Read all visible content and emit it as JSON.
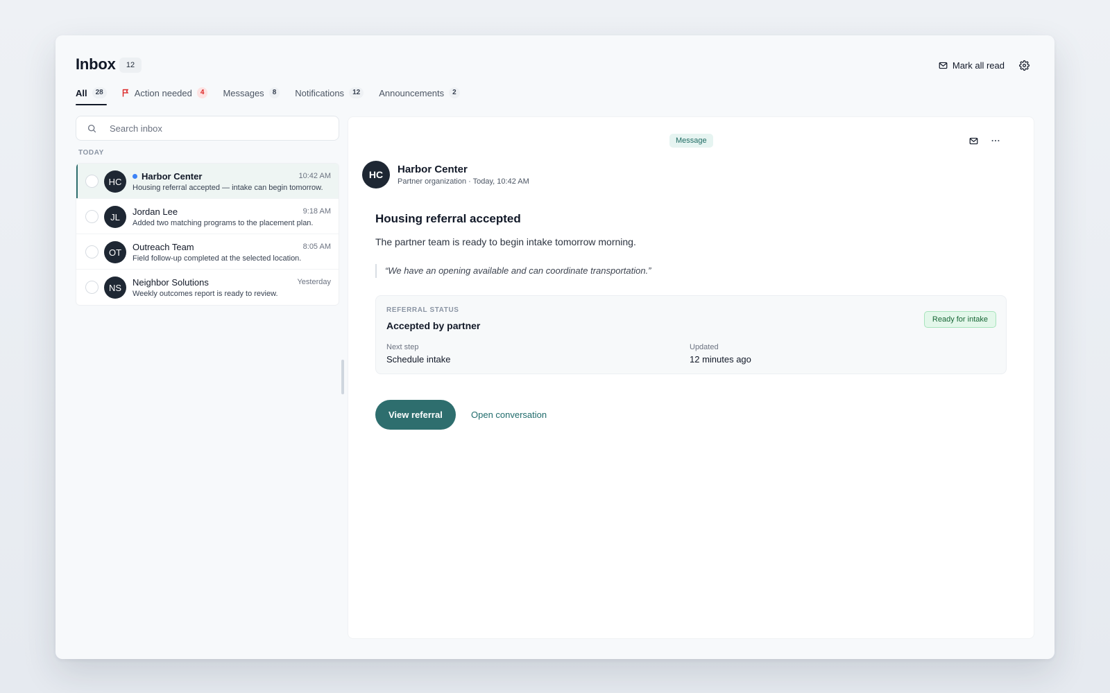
{
  "header": {
    "title": "Inbox",
    "title_count": "12",
    "mark_all_read": "Mark all read"
  },
  "tabs": [
    {
      "label": "All",
      "count": "28",
      "active": true
    },
    {
      "label": "Action needed",
      "count": "4",
      "icon": "flag-icon"
    },
    {
      "label": "Messages",
      "count": "8"
    },
    {
      "label": "Notifications",
      "count": "12"
    },
    {
      "label": "Announcements",
      "count": "2"
    }
  ],
  "search": {
    "placeholder": "Search inbox",
    "value": ""
  },
  "list": {
    "group_label": "TODAY",
    "items": [
      {
        "initials": "HC",
        "name": "Harbor Center",
        "time": "10:42 AM",
        "preview": "Housing referral accepted — intake can begin tomorrow.",
        "unread": true,
        "selected": true
      },
      {
        "initials": "JL",
        "name": "Jordan Lee",
        "time": "9:18 AM",
        "preview": "Added two matching programs to the placement plan."
      },
      {
        "initials": "OT",
        "name": "Outreach Team",
        "time": "8:05 AM",
        "preview": "Field follow-up completed at the selected location."
      },
      {
        "initials": "NS",
        "name": "Neighbor Solutions",
        "time": "Yesterday",
        "preview": "Weekly outcomes report is ready to review."
      }
    ]
  },
  "detail": {
    "type": "Message",
    "sender": {
      "initials": "HC",
      "name": "Harbor Center",
      "meta": "Partner organization · Today, 10:42 AM"
    },
    "subject": "Housing referral accepted",
    "body": "The partner team is ready to begin intake tomorrow morning.",
    "quote": "“We have an opening available and can coordinate transportation.”",
    "status": {
      "label": "REFERRAL STATUS",
      "value": "Accepted by partner",
      "badge": "Ready for intake",
      "next_step_label": "Next step",
      "next_step_value": "Schedule intake",
      "updated_label": "Updated",
      "updated_value": "12 minutes ago"
    },
    "actions": {
      "primary": "View referral",
      "secondary": "Open conversation"
    }
  },
  "colors": {
    "accent": "#2e6e6e",
    "unread_dot": "#3b82f6",
    "avatar_bg": "#1e2733",
    "badge_green_bg": "#e3f7ea",
    "danger": "#dc2626"
  }
}
